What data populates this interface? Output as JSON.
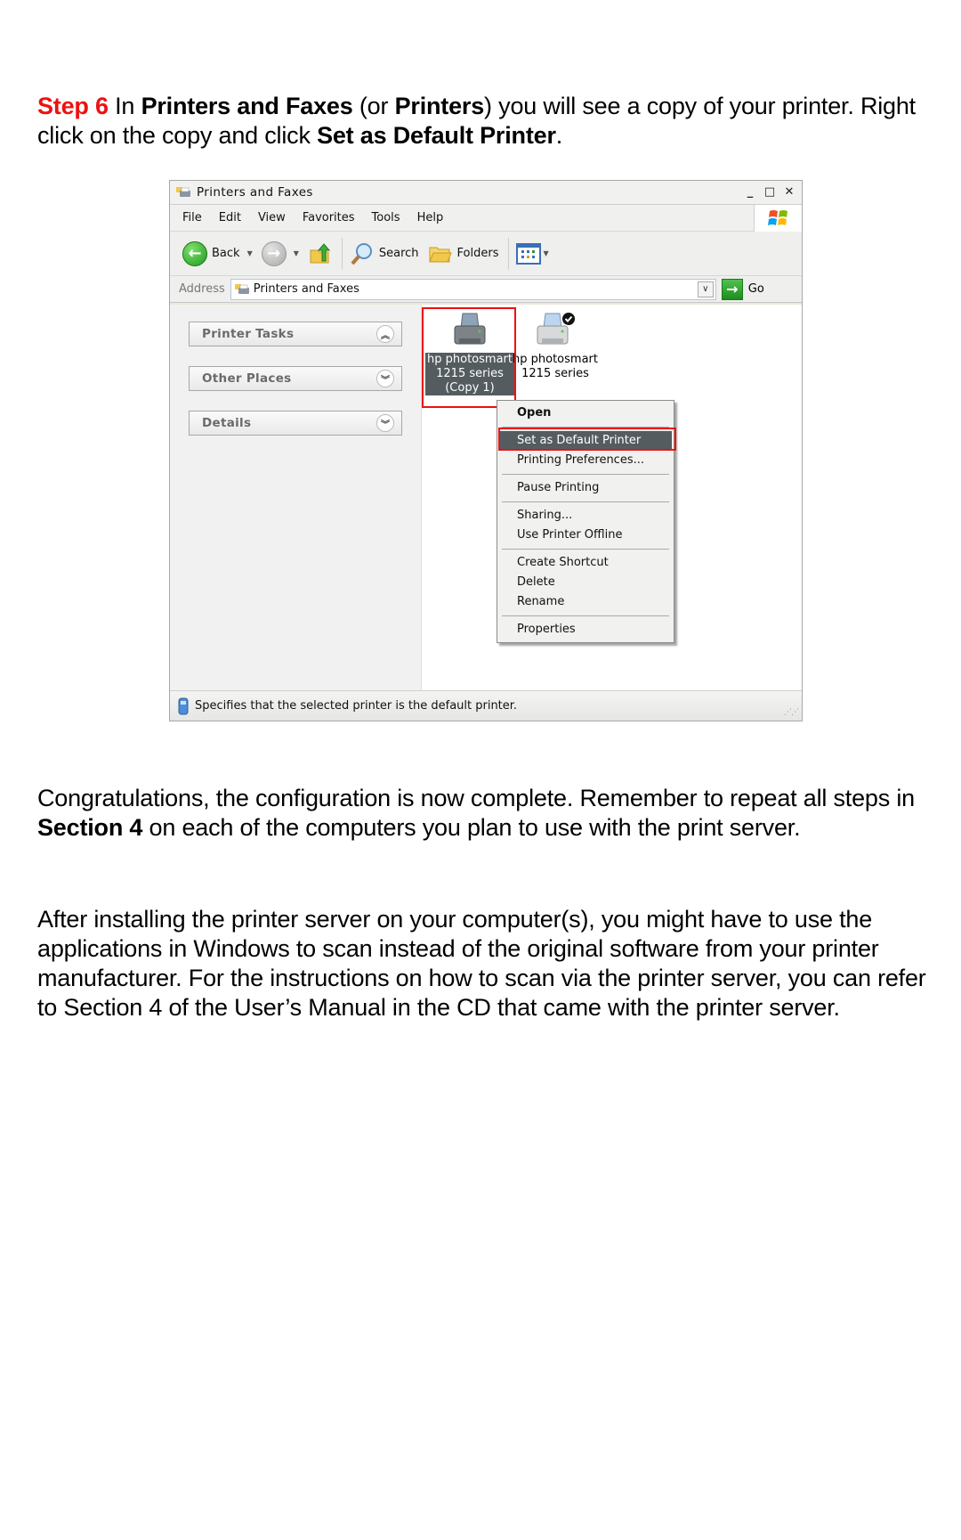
{
  "instructions": {
    "step_label": "Step 6",
    "p1_a": " In ",
    "p1_b": "Printers and Faxes",
    "p1_c": " (or ",
    "p1_d": "Printers",
    "p1_e": ") you will see a copy of your printer. Right click on the copy and click ",
    "p1_f": "Set as Default Printer",
    "p1_g": "."
  },
  "window": {
    "title": "Printers and Faxes",
    "controls": {
      "minimize": "_",
      "maximize": "□",
      "close": "✕"
    },
    "menu": [
      "File",
      "Edit",
      "View",
      "Favorites",
      "Tools",
      "Help"
    ],
    "toolbar": {
      "back": "Back",
      "search": "Search",
      "folders": "Folders"
    },
    "address": {
      "label": "Address",
      "value": "Printers and Faxes",
      "go": "Go"
    },
    "left_panels": [
      {
        "label": "Printer Tasks",
        "state": "expanded"
      },
      {
        "label": "Other Places",
        "state": "collapsed"
      },
      {
        "label": "Details",
        "state": "collapsed"
      }
    ],
    "printers": [
      {
        "line1": "hp photosmart",
        "line2": "1215 series",
        "line3": "(Copy 1)",
        "selected": true,
        "default": false
      },
      {
        "line1": "hp photosmart",
        "line2": "1215 series",
        "default": true
      }
    ],
    "context_menu": {
      "open": "Open",
      "set_default": "Set as Default Printer",
      "preferences": "Printing Preferences...",
      "pause": "Pause Printing",
      "sharing": "Sharing...",
      "offline": "Use Printer Offline",
      "shortcut": "Create Shortcut",
      "delete": "Delete",
      "rename": "Rename",
      "properties": "Properties"
    },
    "status": "Specifies that the selected printer is the default printer."
  },
  "paragraph2": {
    "a": "Congratulations, the configuration is now complete.  Remember to repeat all steps in ",
    "b": "Section 4",
    "c": " on each of the computers you plan to use with the print server."
  },
  "paragraph3": "After installing the printer server on your computer(s), you might have to use the applications in Windows to scan instead of the original software from your printer manufacturer. For the instructions on how to scan via the printer server, you can refer to Section 4 of the User’s Manual in the CD that came with the printer server.",
  "colors": {
    "step_red": "#ee1111",
    "highlight_box": "#ee1111",
    "selection": "#555c60"
  }
}
